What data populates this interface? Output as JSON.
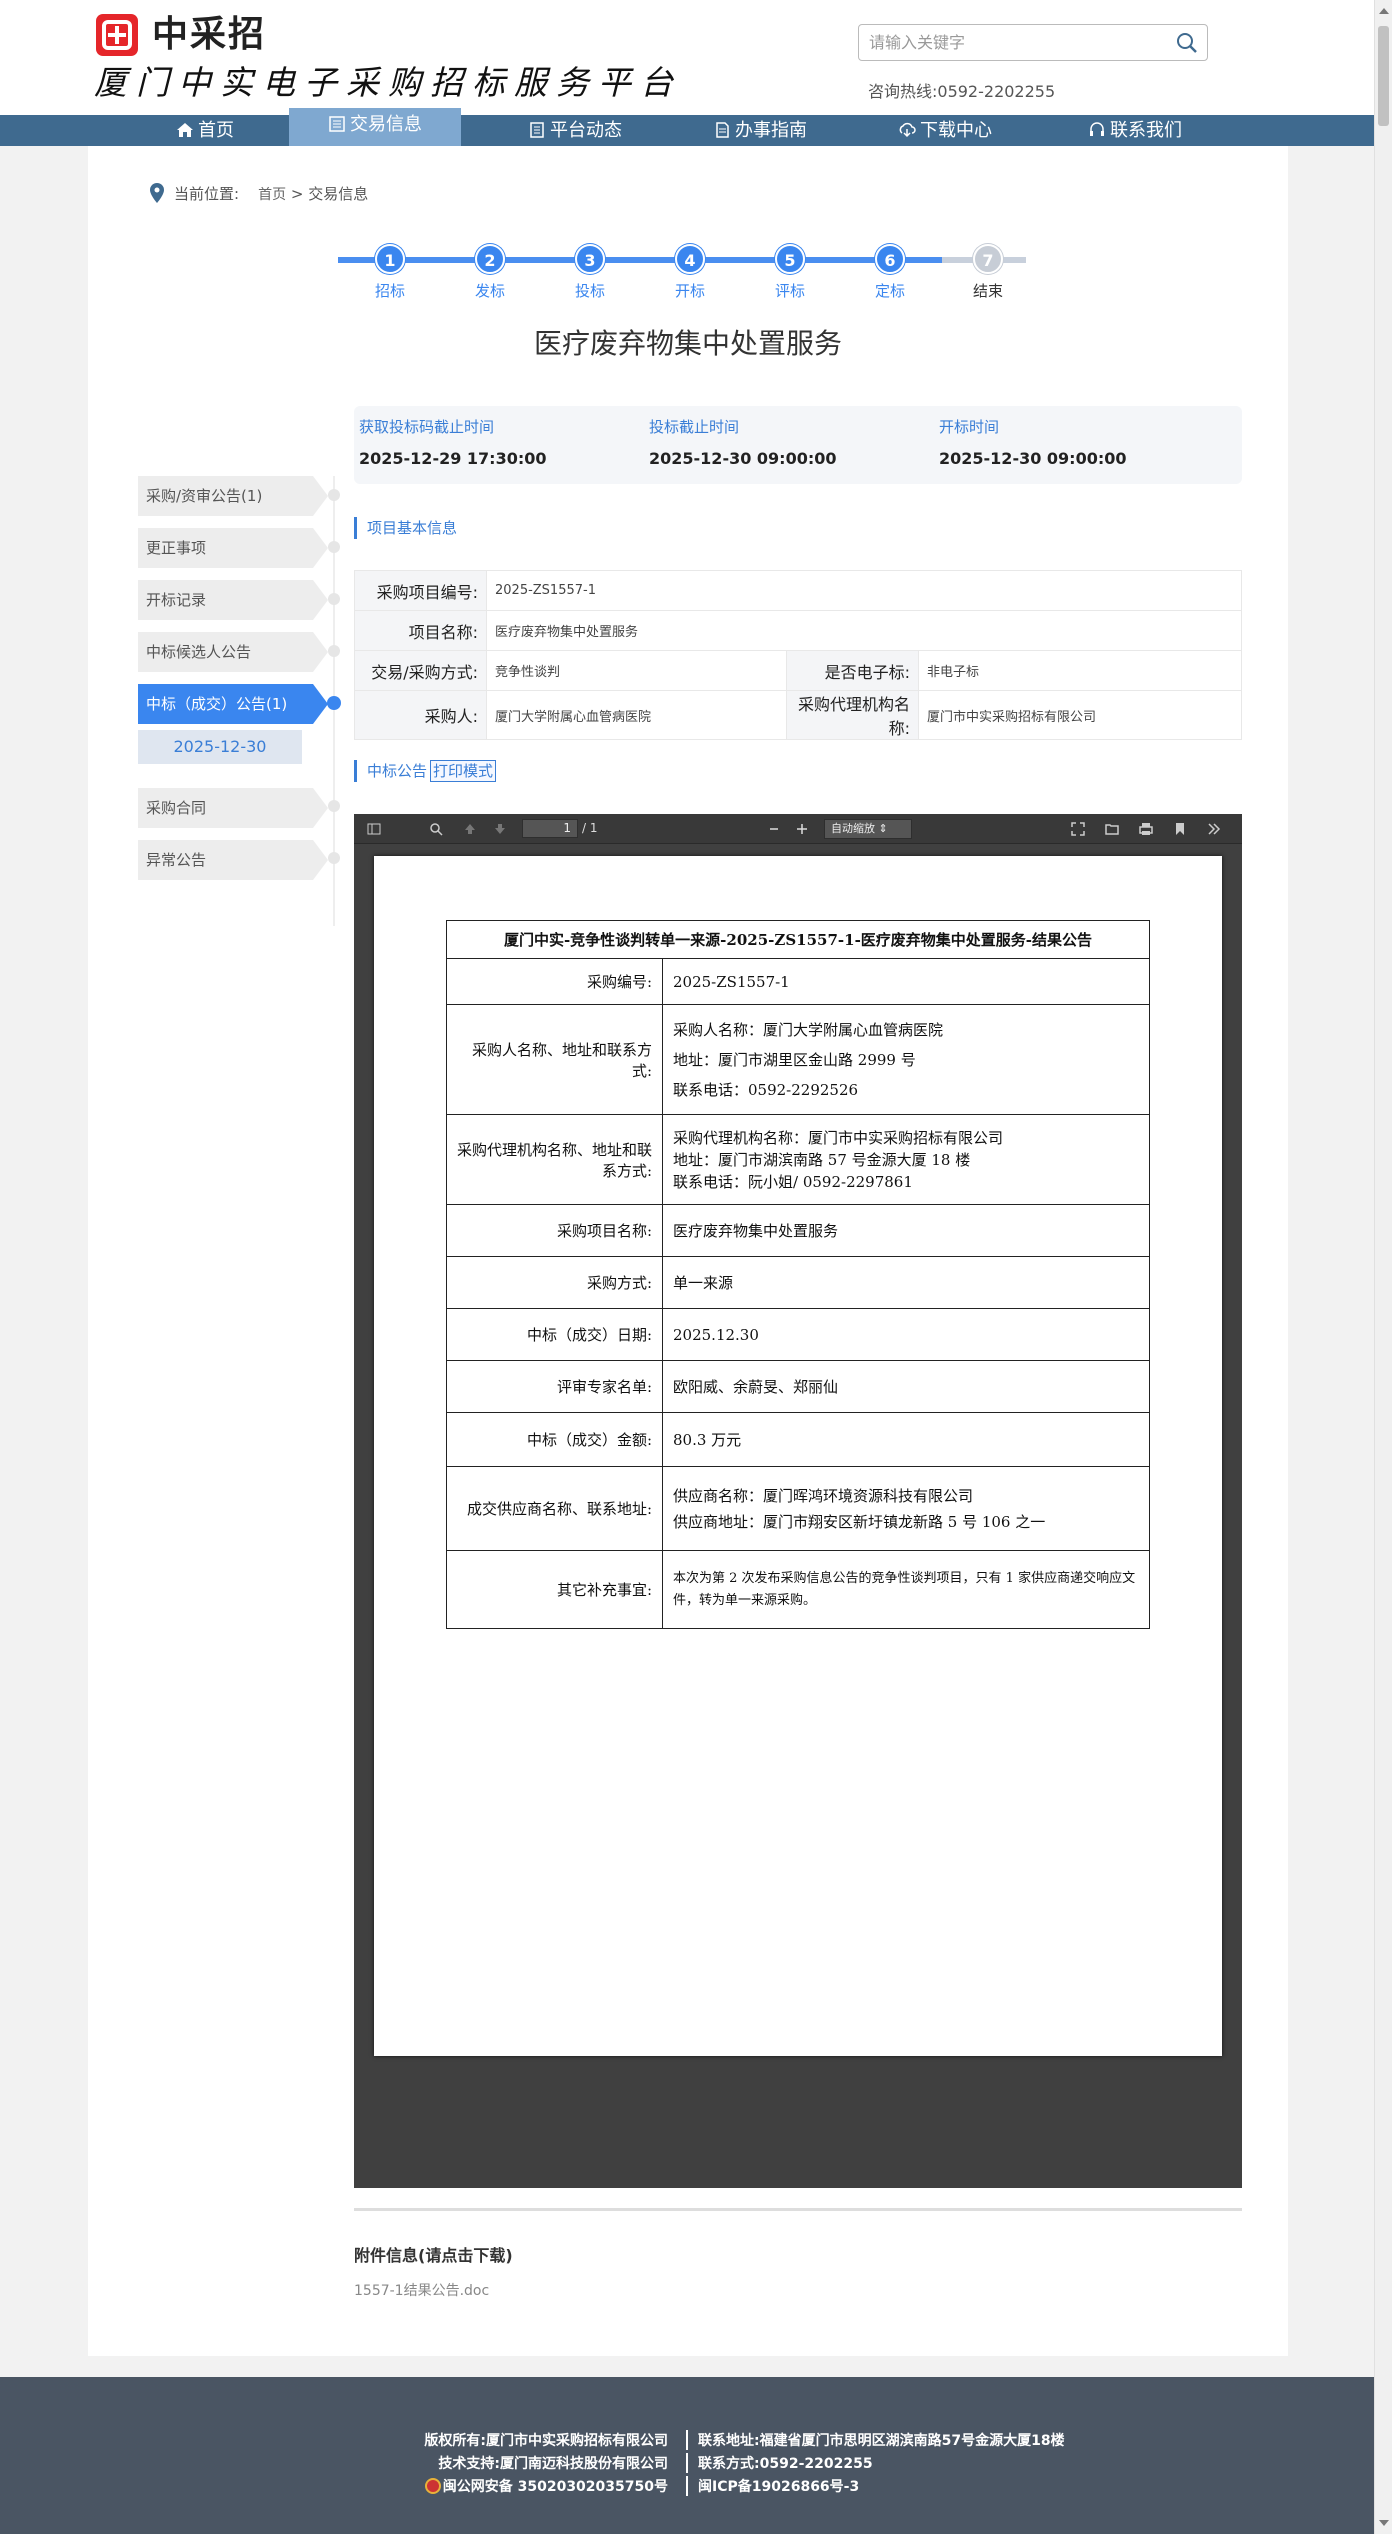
{
  "header": {
    "logo_text": "中采招",
    "site_title": "厦门中实电子采购招标服务平台",
    "search_placeholder": "请输入关键字",
    "hotline": "咨询热线:0592-2202255"
  },
  "nav": [
    {
      "label": "首页",
      "icon": "home-icon"
    },
    {
      "label": "交易信息",
      "icon": "list-icon",
      "active": true
    },
    {
      "label": "平台动态",
      "icon": "news-icon"
    },
    {
      "label": "办事指南",
      "icon": "doc-icon"
    },
    {
      "label": "下载中心",
      "icon": "download-icon"
    },
    {
      "label": "联系我们",
      "icon": "headset-icon"
    }
  ],
  "breadcrumb": {
    "label": "当前位置:",
    "home": "首页",
    "sep": ">",
    "current": "交易信息"
  },
  "steps": [
    {
      "num": "1",
      "label": "招标"
    },
    {
      "num": "2",
      "label": "发标"
    },
    {
      "num": "3",
      "label": "投标"
    },
    {
      "num": "4",
      "label": "开标"
    },
    {
      "num": "5",
      "label": "评标"
    },
    {
      "num": "6",
      "label": "定标"
    },
    {
      "num": "7",
      "label": "结束"
    }
  ],
  "project_title": "医疗废弃物集中处置服务",
  "times": [
    {
      "label": "获取投标码截止时间",
      "value": "2025-12-29 17:30:00"
    },
    {
      "label": "投标截止时间",
      "value": "2025-12-30 09:00:00"
    },
    {
      "label": "开标时间",
      "value": "2025-12-30 09:00:00"
    }
  ],
  "side_menu": [
    {
      "label": "采购/资审公告(1)"
    },
    {
      "label": "更正事项"
    },
    {
      "label": "开标记录"
    },
    {
      "label": "中标候选人公告"
    },
    {
      "label": "中标（成交）公告(1)",
      "active": true
    },
    {
      "label": "采购合同"
    },
    {
      "label": "异常公告"
    }
  ],
  "side_sub_date": "2025-12-30",
  "basic_info": {
    "section_title": "项目基本信息",
    "project_no_key": "采购项目编号:",
    "project_no": "2025-ZS1557-1",
    "project_name_key": "项目名称:",
    "project_name": "医疗废弃物集中处置服务",
    "method_key": "交易/采购方式:",
    "method": "竞争性谈判",
    "electronic_key": "是否电子标:",
    "electronic": "非电子标",
    "purchaser_key": "采购人:",
    "purchaser": "厦门大学附属心血管病医院",
    "agency_key": "采购代理机构名称:",
    "agency": "厦门市中实采购招标有限公司"
  },
  "notice_section": {
    "title": "中标公告",
    "print_btn": "打印模式"
  },
  "pdf": {
    "page_num": "1",
    "page_count": "/ 1",
    "zoom": "自动缩放",
    "doc_title": "厦门中实-竞争性谈判转单一来源-2025-ZS1557-1-医疗废弃物集中处置服务-结果公告",
    "rows": [
      {
        "k": "采购编号:",
        "v": [
          "2025-ZS1557-1"
        ]
      },
      {
        "k": "采购人名称、地址和联系方式:",
        "v": [
          "采购人名称：厦门大学附属心血管病医院",
          "地址：厦门市湖里区金山路 2999 号",
          "联系电话：0592-2292526"
        ]
      },
      {
        "k": "采购代理机构名称、地址和联系方式:",
        "v": [
          "采购代理机构名称：厦门市中实采购招标有限公司",
          "地址：厦门市湖滨南路 57 号金源大厦 18 楼",
          "联系电话：阮小姐/ 0592-2297861"
        ]
      },
      {
        "k": "采购项目名称:",
        "v": [
          "医疗废弃物集中处置服务"
        ]
      },
      {
        "k": "采购方式:",
        "v": [
          "单一来源"
        ]
      },
      {
        "k": "中标（成交）日期:",
        "v": [
          "2025.12.30"
        ]
      },
      {
        "k": "评审专家名单:",
        "v": [
          "欧阳威、余蔚旻、郑丽仙"
        ]
      },
      {
        "k": "中标（成交）金额:",
        "v": [
          "80.3 万元"
        ]
      },
      {
        "k": "成交供应商名称、联系地址:",
        "v": [
          "供应商名称：厦门晖鸿环境资源科技有限公司",
          "供应商地址：厦门市翔安区新圩镇龙新路 5 号 106 之一"
        ]
      },
      {
        "k": "其它补充事宜:",
        "v": [
          "本次为第 2 次发布采购信息公告的竞争性谈判项目，只有 1 家供应商递交响应文件，转为单一来源采购。"
        ]
      }
    ]
  },
  "attachments": {
    "title": "附件信息(请点击下载)",
    "file": "1557-1结果公告.doc"
  },
  "footer": {
    "copyright": "版权所有:厦门市中实采购招标有限公司",
    "address": "联系地址:福建省厦门市思明区湖滨南路57号金源大厦18楼",
    "tech": "技术支持:厦门南迈科技股份有限公司",
    "contact": "联系方式:0592-2202255",
    "police": "闽公网安备 35020302035750号",
    "icp": "闽ICP备19026866号-3"
  }
}
